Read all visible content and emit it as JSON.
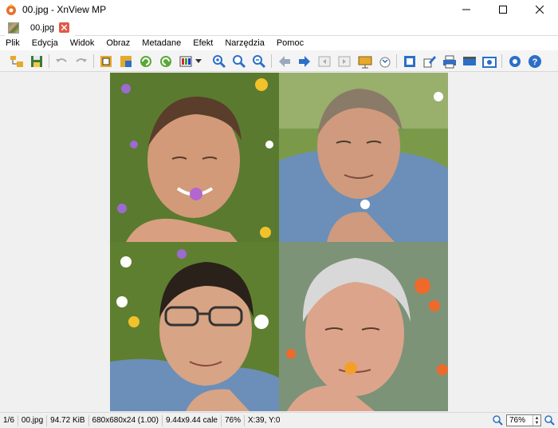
{
  "window": {
    "title": "00.jpg - XnView MP"
  },
  "tab": {
    "label": "00.jpg"
  },
  "menu": [
    "Plik",
    "Edycja",
    "Widok",
    "Obraz",
    "Metadane",
    "Efekt",
    "Narzędzia",
    "Pomoc"
  ],
  "toolbar": {
    "buttons": [
      "browser-icon",
      "save-icon",
      "undo-icon",
      "redo-icon",
      "crop-icon",
      "resize-icon",
      "rotate-left-icon",
      "rotate-right-icon",
      "adjust-colors-icon",
      "dropdown-arrow-icon",
      "zoom-in-icon",
      "zoom-fit-icon",
      "zoom-out-icon",
      "previous-icon",
      "next-icon",
      "first-page-icon",
      "last-page-icon",
      "slideshow-icon",
      "compare-icon",
      "fullscreen-icon",
      "edit-icon",
      "print-icon",
      "scanner-icon",
      "capture-icon",
      "settings-icon",
      "help-icon"
    ]
  },
  "status": {
    "index": "1/6",
    "filename": "00.jpg",
    "filesize": "94.72 KiB",
    "dimensions": "680x680x24 (1.00)",
    "print_size": "9.44x9.44 cale",
    "zoom_percent": "76%",
    "cursor": "X:39, Y:0",
    "zoom_value": "76%"
  },
  "colors": {
    "accent": "#e25a46",
    "toolbar_blue": "#2b6fc9"
  }
}
